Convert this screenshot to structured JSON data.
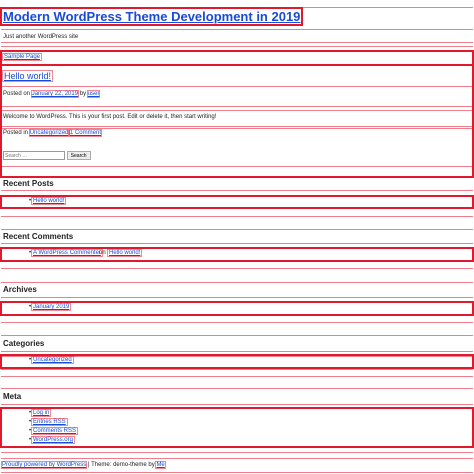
{
  "site": {
    "title": "Modern WordPress Theme Development in 2019",
    "tagline": "Just another WordPress site"
  },
  "nav": {
    "items": [
      {
        "label": "Sample Page"
      }
    ]
  },
  "post": {
    "title": "Hello world!",
    "meta_prefix": "Posted on",
    "date": "January 22, 2019",
    "by_prefix": "by",
    "author": "user",
    "body": "Welcome to WordPress. This is your first post. Edit or delete it, then start writing!",
    "posted_in_prefix": "Posted in",
    "category": "Uncategorized",
    "separator": "|",
    "comments": "1 Comment"
  },
  "search": {
    "placeholder": "Search …",
    "button_label": "Search"
  },
  "widgets": {
    "recent_posts": {
      "title": "Recent Posts",
      "items": [
        "Hello world!"
      ]
    },
    "recent_comments": {
      "title": "Recent Comments",
      "commenter": "A WordPress Commenter",
      "on_text": "on",
      "post": "Hello world!"
    },
    "archives": {
      "title": "Archives",
      "items": [
        "January 2019"
      ]
    },
    "categories": {
      "title": "Categories",
      "items": [
        "Uncategorized"
      ]
    },
    "meta": {
      "title": "Meta",
      "items": [
        "Log in",
        "Entries RSS",
        "Comments RSS",
        "WordPress.org"
      ]
    }
  },
  "footer": {
    "powered_by": "Proudly powered by WordPress",
    "separator": "|",
    "theme_prefix": "Theme: demo-theme by",
    "theme_author": "Me"
  }
}
